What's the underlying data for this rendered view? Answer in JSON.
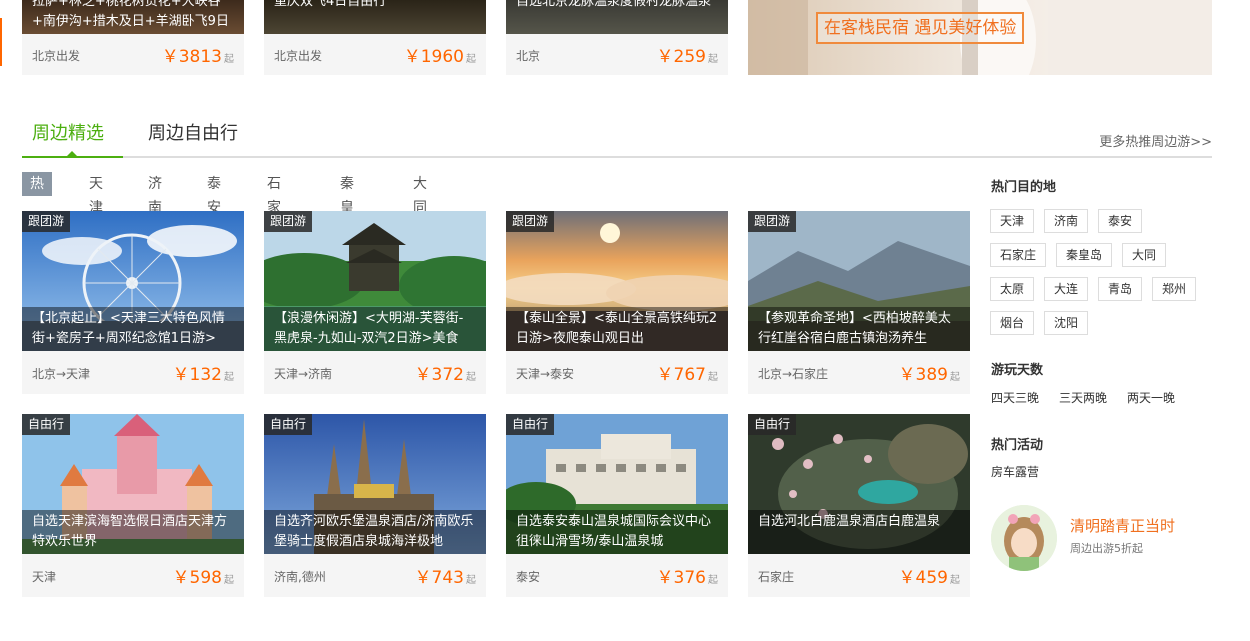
{
  "top_cards": [
    {
      "title": "拉萨+林芝+桃花树贡花+大峡谷+南伊沟+措木及日+羊湖卧飞9日",
      "from": "北京出发",
      "price": "￥3813",
      "unit": "起"
    },
    {
      "title": "重庆双飞4日自由行",
      "from": "北京出发",
      "price": "￥1960",
      "unit": "起"
    },
    {
      "title": "自选北京龙脉温泉度假村龙脉温泉",
      "from": "北京",
      "price": "￥259",
      "unit": "起"
    }
  ],
  "banner": {
    "slogan": "在客栈民宿 遇见美好体验"
  },
  "tabs": [
    {
      "label": "周边精选",
      "active": true
    },
    {
      "label": "周边自由行",
      "active": false
    }
  ],
  "more_link": "更多热推周边游>>",
  "filters": [
    "热推",
    "天津",
    "济南",
    "泰安",
    "石家庄",
    "秦皇岛",
    "大同"
  ],
  "cards": [
    {
      "tag": "跟团游",
      "title": "【北京起止】<天津三大特色风情街+瓷房子+周邓纪念馆1日游>",
      "route": "北京→天津",
      "price": "￥132",
      "unit": "起"
    },
    {
      "tag": "跟团游",
      "title": "【浪漫休闲游】<大明湖-芙蓉街-黑虎泉-九如山-双汽2日游>美食",
      "route": "天津→济南",
      "price": "￥372",
      "unit": "起"
    },
    {
      "tag": "跟团游",
      "title": "【泰山全景】<泰山全景高铁纯玩2日游>夜爬泰山观日出",
      "route": "天津→泰安",
      "price": "￥767",
      "unit": "起"
    },
    {
      "tag": "跟团游",
      "title": "【参观革命圣地】<西柏坡醉美太行红崖谷宿白鹿古镇泡汤养生",
      "route": "北京→石家庄",
      "price": "￥389",
      "unit": "起"
    },
    {
      "tag": "自由行",
      "title": "自选天津滨海智选假日酒店天津方特欢乐世界",
      "route": "天津",
      "price": "￥598",
      "unit": "起"
    },
    {
      "tag": "自由行",
      "title": "自选齐河欧乐堡温泉酒店/济南欧乐堡骑士度假酒店泉城海洋极地",
      "route": "济南,德州",
      "price": "￥743",
      "unit": "起"
    },
    {
      "tag": "自由行",
      "title": "自选泰安泰山温泉城国际会议中心徂徕山滑雪场/泰山温泉城",
      "route": "泰安",
      "price": "￥376",
      "unit": "起"
    },
    {
      "tag": "自由行",
      "title": "自选河北白鹿温泉酒店白鹿温泉",
      "route": "石家庄",
      "price": "￥459",
      "unit": "起"
    }
  ],
  "sidebar": {
    "dest_title": "热门目的地",
    "destinations": [
      "天津",
      "济南",
      "泰安",
      "石家庄",
      "秦皇岛",
      "大同",
      "太原",
      "大连",
      "青岛",
      "郑州",
      "烟台",
      "沈阳"
    ],
    "days_title": "游玩天数",
    "days": [
      "四天三晚",
      "三天两晚",
      "两天一晚"
    ],
    "activity_title": "热门活动",
    "activities": [
      "房车露营"
    ],
    "promo_title": "清明踏青正当时",
    "promo_sub": "周边出游5折起"
  }
}
